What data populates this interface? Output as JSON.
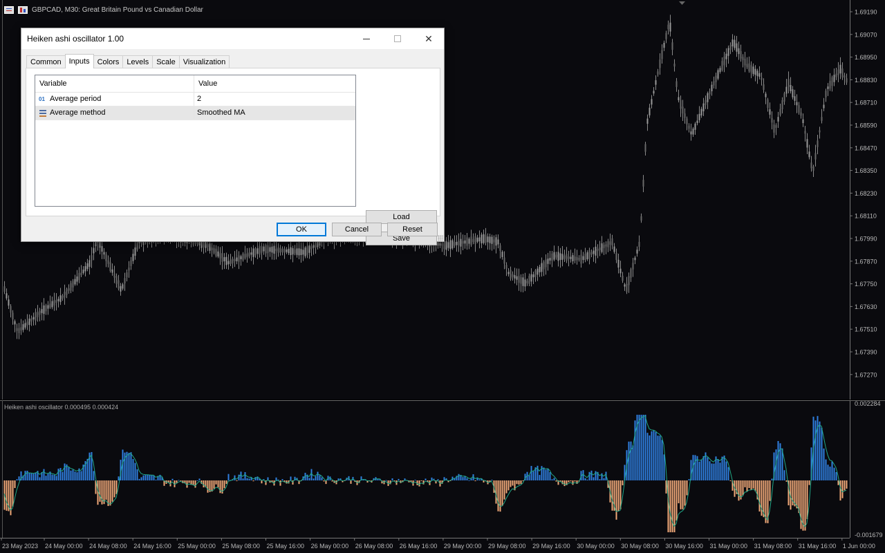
{
  "chart": {
    "symbol_header": "GBPCAD, M30:  Great Britain Pound vs Canadian Dollar",
    "price_labels": [
      "1.69190",
      "1.69070",
      "1.68950",
      "1.68830",
      "1.68710",
      "1.68590",
      "1.68470",
      "1.68350",
      "1.68230",
      "1.68110",
      "1.67990",
      "1.67870",
      "1.67750",
      "1.67630",
      "1.67510",
      "1.67390",
      "1.67270"
    ],
    "indicator_label": "Heiken ashi oscillator 0.000495 0.000424",
    "indicator_scale": [
      "0.002284",
      "-0.001679"
    ],
    "time_labels": [
      "23 May 2023",
      "24 May 00:00",
      "24 May 08:00",
      "24 May 16:00",
      "25 May 00:00",
      "25 May 08:00",
      "25 May 16:00",
      "26 May 00:00",
      "26 May 08:00",
      "26 May 16:00",
      "29 May 00:00",
      "29 May 08:00",
      "29 May 16:00",
      "30 May 00:00",
      "30 May 08:00",
      "30 May 16:00",
      "31 May 00:00",
      "31 May 08:00",
      "31 May 16:00",
      "1 Jun 00:00"
    ],
    "colors": {
      "background": "#0a0a0e",
      "candles": "#8a8a8a",
      "hist_up": "#2f7fe0",
      "hist_down": "#f0a878",
      "signal": "#20a888"
    }
  },
  "dialog": {
    "title": "Heiken ashi oscillator 1.00",
    "window_controls": {
      "minimize": "minimize-icon",
      "maximize": "maximize-icon",
      "close": "close-icon",
      "close_glyph": "✕"
    },
    "tabs": [
      {
        "label": "Common"
      },
      {
        "label": "Inputs",
        "active": true
      },
      {
        "label": "Colors"
      },
      {
        "label": "Levels"
      },
      {
        "label": "Scale"
      },
      {
        "label": "Visualization"
      }
    ],
    "grid": {
      "headers": {
        "variable": "Variable",
        "value": "Value"
      },
      "rows": [
        {
          "icon": "01",
          "variable": "Average period",
          "value": "2"
        },
        {
          "icon": "list-icon",
          "variable": "Average method",
          "value": "Smoothed MA"
        }
      ]
    },
    "buttons": {
      "load": "Load",
      "save": "Save",
      "ok": "OK",
      "cancel": "Cancel",
      "reset": "Reset"
    }
  }
}
